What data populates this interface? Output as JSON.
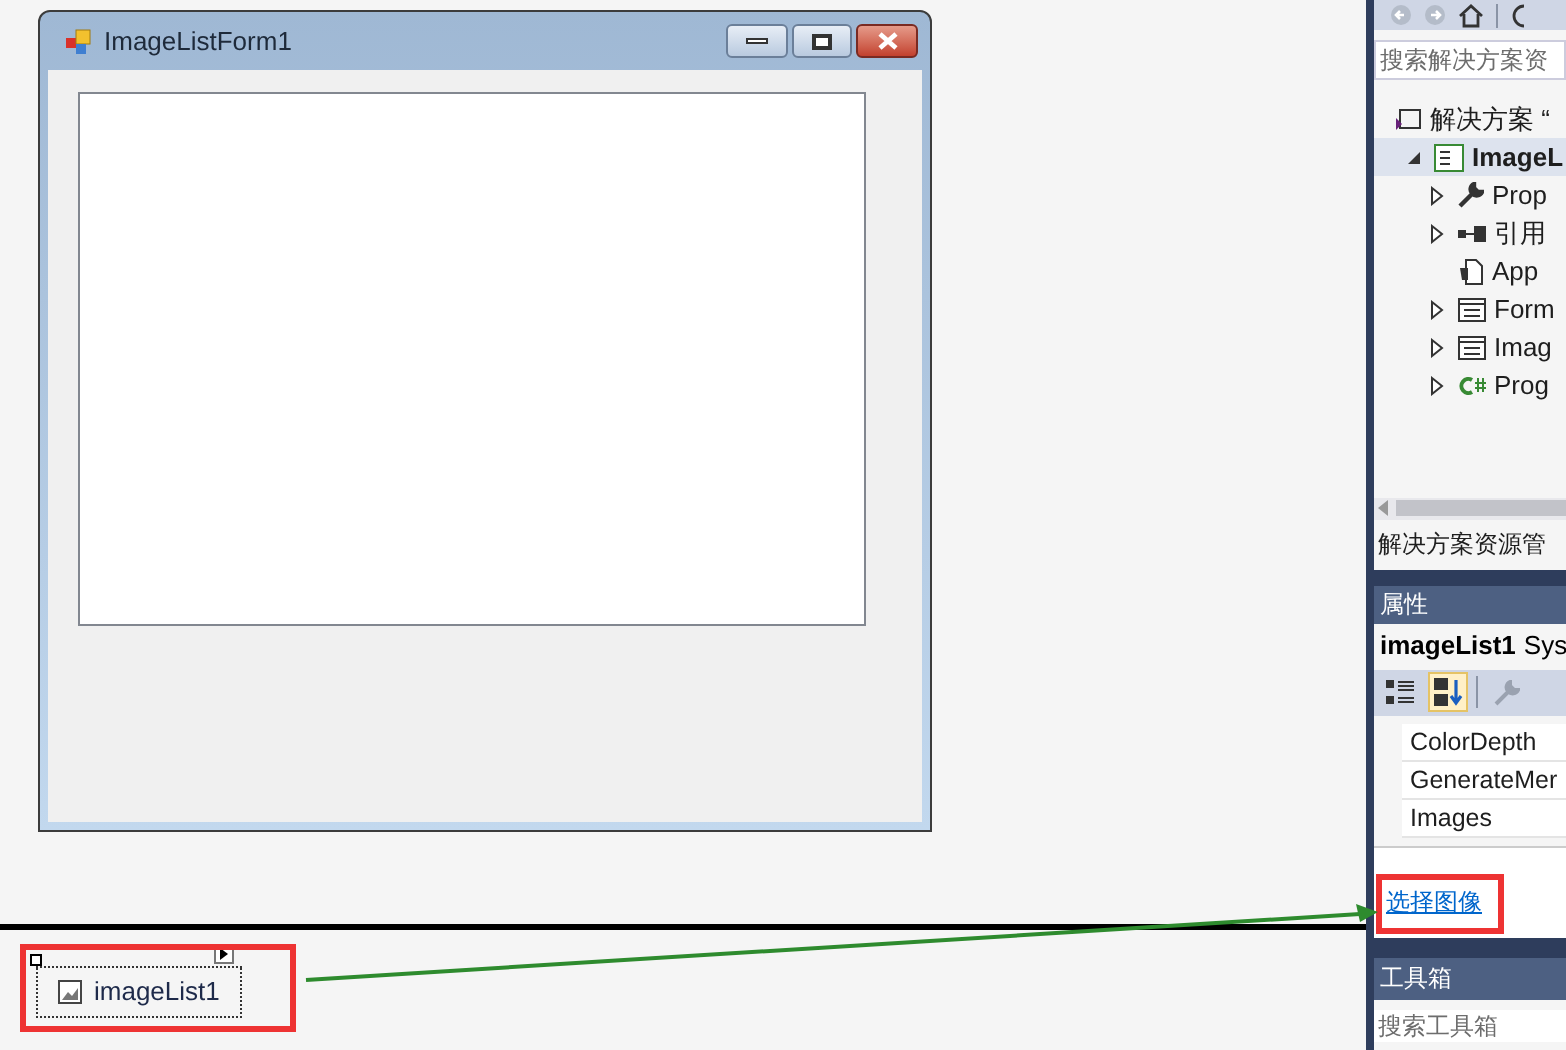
{
  "form_window": {
    "title": "ImageListForm1"
  },
  "component_tray": {
    "items": [
      {
        "name": "imageList1",
        "selected": true
      }
    ]
  },
  "solution_explorer": {
    "search": {
      "placeholder": "搜索解决方案资"
    },
    "tree": [
      {
        "label": "解决方案 “",
        "kind": "solution",
        "selected": false,
        "children": [
          {
            "label": "ImageL",
            "kind": "project",
            "expanded": true,
            "selected": true,
            "children": [
              {
                "label": "Prop",
                "kind": "wrench",
                "expanded": false,
                "selected": false
              },
              {
                "label": "引用",
                "kind": "references",
                "expanded": false,
                "selected": false
              },
              {
                "label": "App",
                "kind": "config",
                "selected": false
              },
              {
                "label": "Form",
                "kind": "form",
                "expanded": false,
                "selected": false
              },
              {
                "label": "Imag",
                "kind": "form",
                "expanded": false,
                "selected": false
              },
              {
                "label": "Prog",
                "kind": "csharp",
                "expanded": false,
                "selected": false
              }
            ]
          }
        ]
      }
    ],
    "footer_tab": "解决方案资源管"
  },
  "properties": {
    "title": "属性",
    "object": "imageList1",
    "type": "Sys",
    "toolbar": [
      {
        "kind": "categorized",
        "selected": false
      },
      {
        "kind": "alphabetical",
        "selected": true
      },
      {
        "kind": "pages",
        "selected": false
      }
    ],
    "rows": [
      "ColorDepth",
      "GenerateMer",
      "Images"
    ],
    "link": "选择图像"
  },
  "toolbox": {
    "title": "工具箱",
    "search": {
      "placeholder": "搜索工具箱"
    }
  }
}
